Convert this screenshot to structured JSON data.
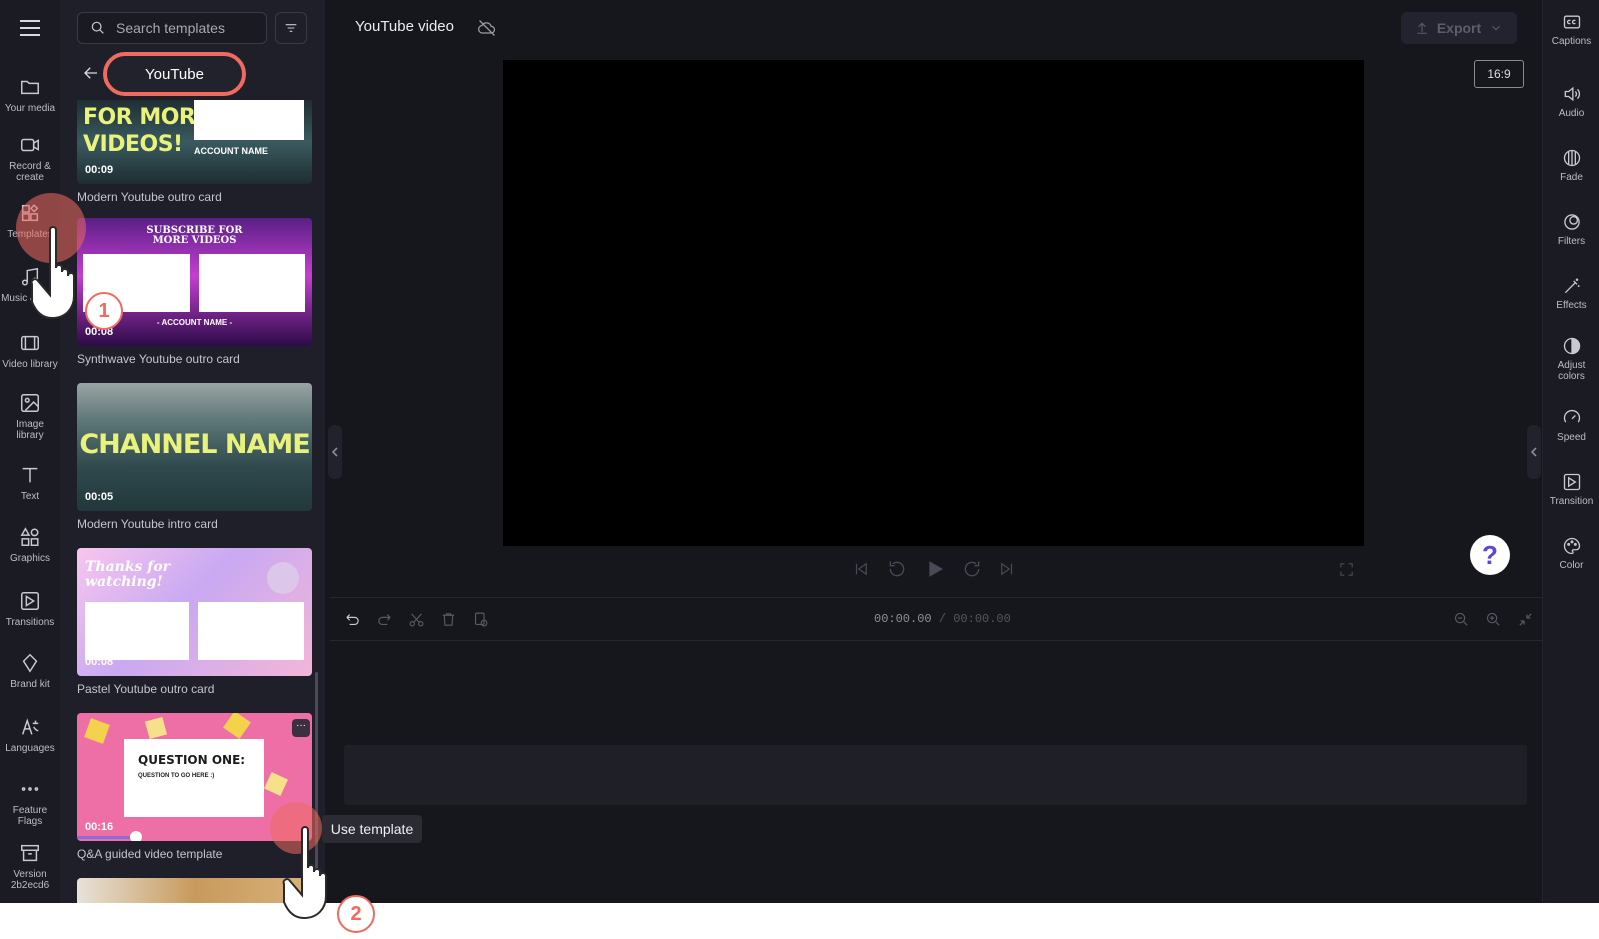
{
  "project": {
    "title": "YouTube video"
  },
  "search": {
    "placeholder": "Search templates"
  },
  "category": {
    "label": "YouTube"
  },
  "left_nav": [
    {
      "label": "Your media",
      "icon": "folder-icon"
    },
    {
      "label": "Record &\ncreate",
      "icon": "camera-icon"
    },
    {
      "label": "Templates",
      "icon": "templates-icon"
    },
    {
      "label": "Music & SFX",
      "icon": "music-icon"
    },
    {
      "label": "Video library",
      "icon": "film-icon"
    },
    {
      "label": "Image\nlibrary",
      "icon": "image-icon"
    },
    {
      "label": "Text",
      "icon": "text-icon"
    },
    {
      "label": "Graphics",
      "icon": "shapes-icon"
    },
    {
      "label": "Transitions",
      "icon": "transition-icon"
    },
    {
      "label": "Brand kit",
      "icon": "brand-icon"
    },
    {
      "label": "Languages",
      "icon": "languages-icon"
    },
    {
      "label": "Feature\nFlags",
      "icon": "more-icon"
    },
    {
      "label": "Version\n2b2ecd6",
      "icon": "archive-icon"
    }
  ],
  "templates": [
    {
      "name": "Modern Youtube outro card",
      "duration": "00:09",
      "thumb": {
        "line1": "FOR MORE",
        "line2": "VIDEOS!",
        "account": "ACCOUNT NAME"
      }
    },
    {
      "name": "Synthwave Youtube outro card",
      "duration": "00:08",
      "thumb": {
        "line1": "SUBSCRIBE FOR",
        "line2": "MORE VIDEOS",
        "account": "- ACCOUNT NAME -"
      }
    },
    {
      "name": "Modern Youtube intro card",
      "duration": "00:05",
      "thumb": {
        "line1": "CHANNEL NAME"
      }
    },
    {
      "name": "Pastel Youtube outro card",
      "duration": "00:08",
      "thumb": {
        "line1": "Thanks for",
        "line2": "watching!"
      }
    },
    {
      "name": "Q&A guided video template",
      "duration": "00:16",
      "thumb": {
        "line1": "QUESTION ONE:",
        "line2": "QUESTION TO GO HERE :)"
      }
    }
  ],
  "toolbar": {
    "export_label": "Export",
    "ratio_label": "16:9",
    "help_label": "?"
  },
  "timeline": {
    "current": "00:00.00",
    "total": "/ 00:00.00"
  },
  "right_tools": [
    {
      "label": "Captions",
      "icon": "captions-icon"
    },
    {
      "label": "Audio",
      "icon": "speaker-icon"
    },
    {
      "label": "Fade",
      "icon": "fade-icon"
    },
    {
      "label": "Filters",
      "icon": "filters-icon"
    },
    {
      "label": "Effects",
      "icon": "magic-wand-icon"
    },
    {
      "label": "Adjust\ncolors",
      "icon": "contrast-icon"
    },
    {
      "label": "Speed",
      "icon": "speedometer-icon"
    },
    {
      "label": "Transition",
      "icon": "transition-icon"
    },
    {
      "label": "Color",
      "icon": "palette-icon"
    }
  ],
  "tooltip": {
    "label": "Use template"
  },
  "steps": [
    "1",
    "2"
  ],
  "colors": {
    "highlight": "#ef6a5f",
    "background": "#16161d",
    "help_accent": "#5b47d6"
  }
}
